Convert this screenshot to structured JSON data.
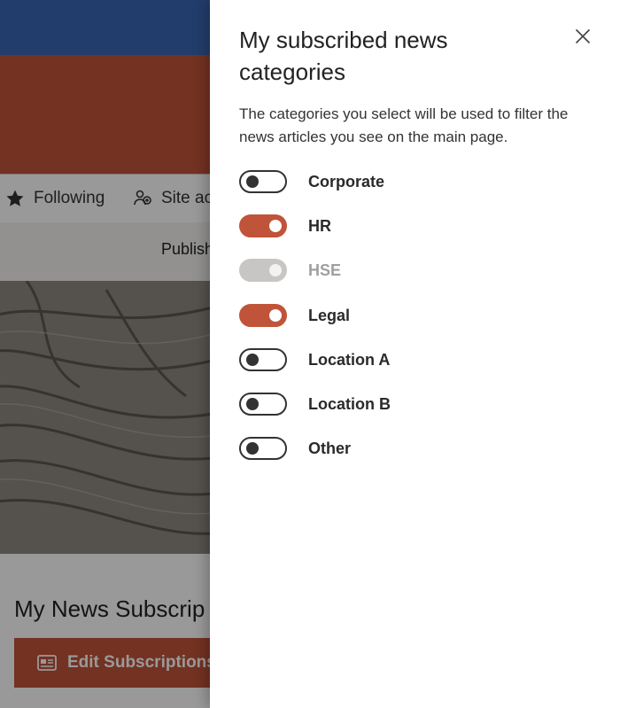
{
  "background": {
    "commandbar": {
      "following_label": "Following",
      "site_access_label": "Site ac"
    },
    "publish_label": "Publish",
    "news_webpart_title": "My News Subscrip",
    "edit_button_label": "Edit Subscriptions"
  },
  "panel": {
    "title": "My subscribed news categories",
    "description": "The categories you select will be used to filter the news articles you see on the main page.",
    "close_icon": "close-icon",
    "categories": [
      {
        "label": "Corporate",
        "state": "off"
      },
      {
        "label": "HR",
        "state": "on"
      },
      {
        "label": "HSE",
        "state": "disabled"
      },
      {
        "label": "Legal",
        "state": "on"
      },
      {
        "label": "Location A",
        "state": "off"
      },
      {
        "label": "Location B",
        "state": "off"
      },
      {
        "label": "Other",
        "state": "off"
      }
    ]
  },
  "colors": {
    "accent": "#c0543a",
    "suitebar": "#3a66b5",
    "toggle_off_border": "#333333",
    "toggle_disabled": "#c8c6c4"
  }
}
